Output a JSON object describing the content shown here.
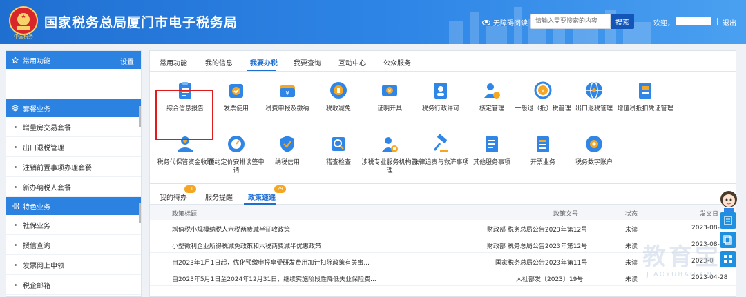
{
  "header": {
    "site_title": "国家税务总局厦门市电子税务局",
    "emblem_label": "中国税务",
    "accessibility_label": "无障碍阅读",
    "search_placeholder": "请输入需要搜索的内容",
    "search_button": "搜索",
    "welcome": "欢迎，",
    "logout": "退出"
  },
  "sidebar": {
    "common": {
      "title": "常用功能",
      "settings": "设置"
    },
    "package": {
      "title": "套餐业务",
      "items": [
        "增量房交易套餐",
        "出口退税管理",
        "注销前置事项办理套餐",
        "新办纳税人套餐"
      ]
    },
    "special": {
      "title": "特色业务",
      "items": [
        "社保业务",
        "授信查询",
        "发票网上申领",
        "税企邮箱"
      ]
    }
  },
  "main": {
    "tabs": [
      "常用功能",
      "我的信息",
      "我要办税",
      "我要查询",
      "互动中心",
      "公众服务"
    ],
    "active_tab": 2,
    "tiles": [
      {
        "label": "综合信息报告",
        "icon": "report-clipboard-icon"
      },
      {
        "label": "发票使用",
        "icon": "invoice-check-icon"
      },
      {
        "label": "税费申报及缴纳",
        "icon": "tax-wallet-icon"
      },
      {
        "label": "税收减免",
        "icon": "tax-reduction-icon"
      },
      {
        "label": "证明开具",
        "icon": "certificate-icon"
      },
      {
        "label": "税务行政许可",
        "icon": "admin-license-icon"
      },
      {
        "label": "核定管理",
        "icon": "assessment-user-icon"
      },
      {
        "label": "一般退（抵）税管理",
        "icon": "refund-cycle-icon"
      },
      {
        "label": "出口退税管理",
        "icon": "export-globe-icon"
      },
      {
        "label": "增值税抵扣凭证管理",
        "icon": "vat-voucher-icon"
      },
      {
        "label": "税务代保管资金收取",
        "icon": "custody-fund-icon"
      },
      {
        "label": "预约定价安排谈签申请",
        "icon": "pricing-gauge-icon"
      },
      {
        "label": "纳税信用",
        "icon": "tax-credit-icon"
      },
      {
        "label": "稽查检查",
        "icon": "audit-inspection-icon"
      },
      {
        "label": "涉税专业服务机构管理",
        "icon": "agency-management-icon"
      },
      {
        "label": "法律追责与救济事项",
        "icon": "legal-gavel-icon"
      },
      {
        "label": "其他服务事项",
        "icon": "other-services-icon"
      },
      {
        "label": "开票业务",
        "icon": "invoice-issue-icon"
      },
      {
        "label": "税务数字账户",
        "icon": "digital-account-icon"
      }
    ]
  },
  "news": {
    "tabs": [
      {
        "label": "我的待办",
        "badge": "11"
      },
      {
        "label": "服务提醒",
        "badge": ""
      },
      {
        "label": "政策速递",
        "badge": "29"
      }
    ],
    "columns": [
      "政策标题",
      "政策文号",
      "状态",
      "发文日"
    ],
    "rows": [
      {
        "title": "增值税小规模纳税人六税两费减半征收政策",
        "doc": "财政部 税务总局公告2023年第12号",
        "status": "未读",
        "date": "2023-08-"
      },
      {
        "title": "小型微利企业所得税减免政策和六税两费减半优惠政策",
        "doc": "财政部 税务总局公告2023年第12号",
        "status": "未读",
        "date": "2023-08-"
      },
      {
        "title": "自2023年1月1日起，优化预缴申报享受研发费用加计扣除政策有关事...",
        "doc": "国家税务总局公告2023年第11号",
        "status": "未读",
        "date": "2023-0"
      },
      {
        "title": "自2023年5月1日至2024年12月31日，继续实施阶段性降低失业保险费...",
        "doc": "人社部发〔2023〕19号",
        "status": "未读",
        "date": "2023-04-28"
      }
    ]
  },
  "watermark": {
    "main": "教育宝",
    "sub": "JIAOYUBAO.CN"
  },
  "colors": {
    "primary": "#1f6fd1",
    "highlight": "#e11b1b",
    "badge": "#f5a623"
  }
}
